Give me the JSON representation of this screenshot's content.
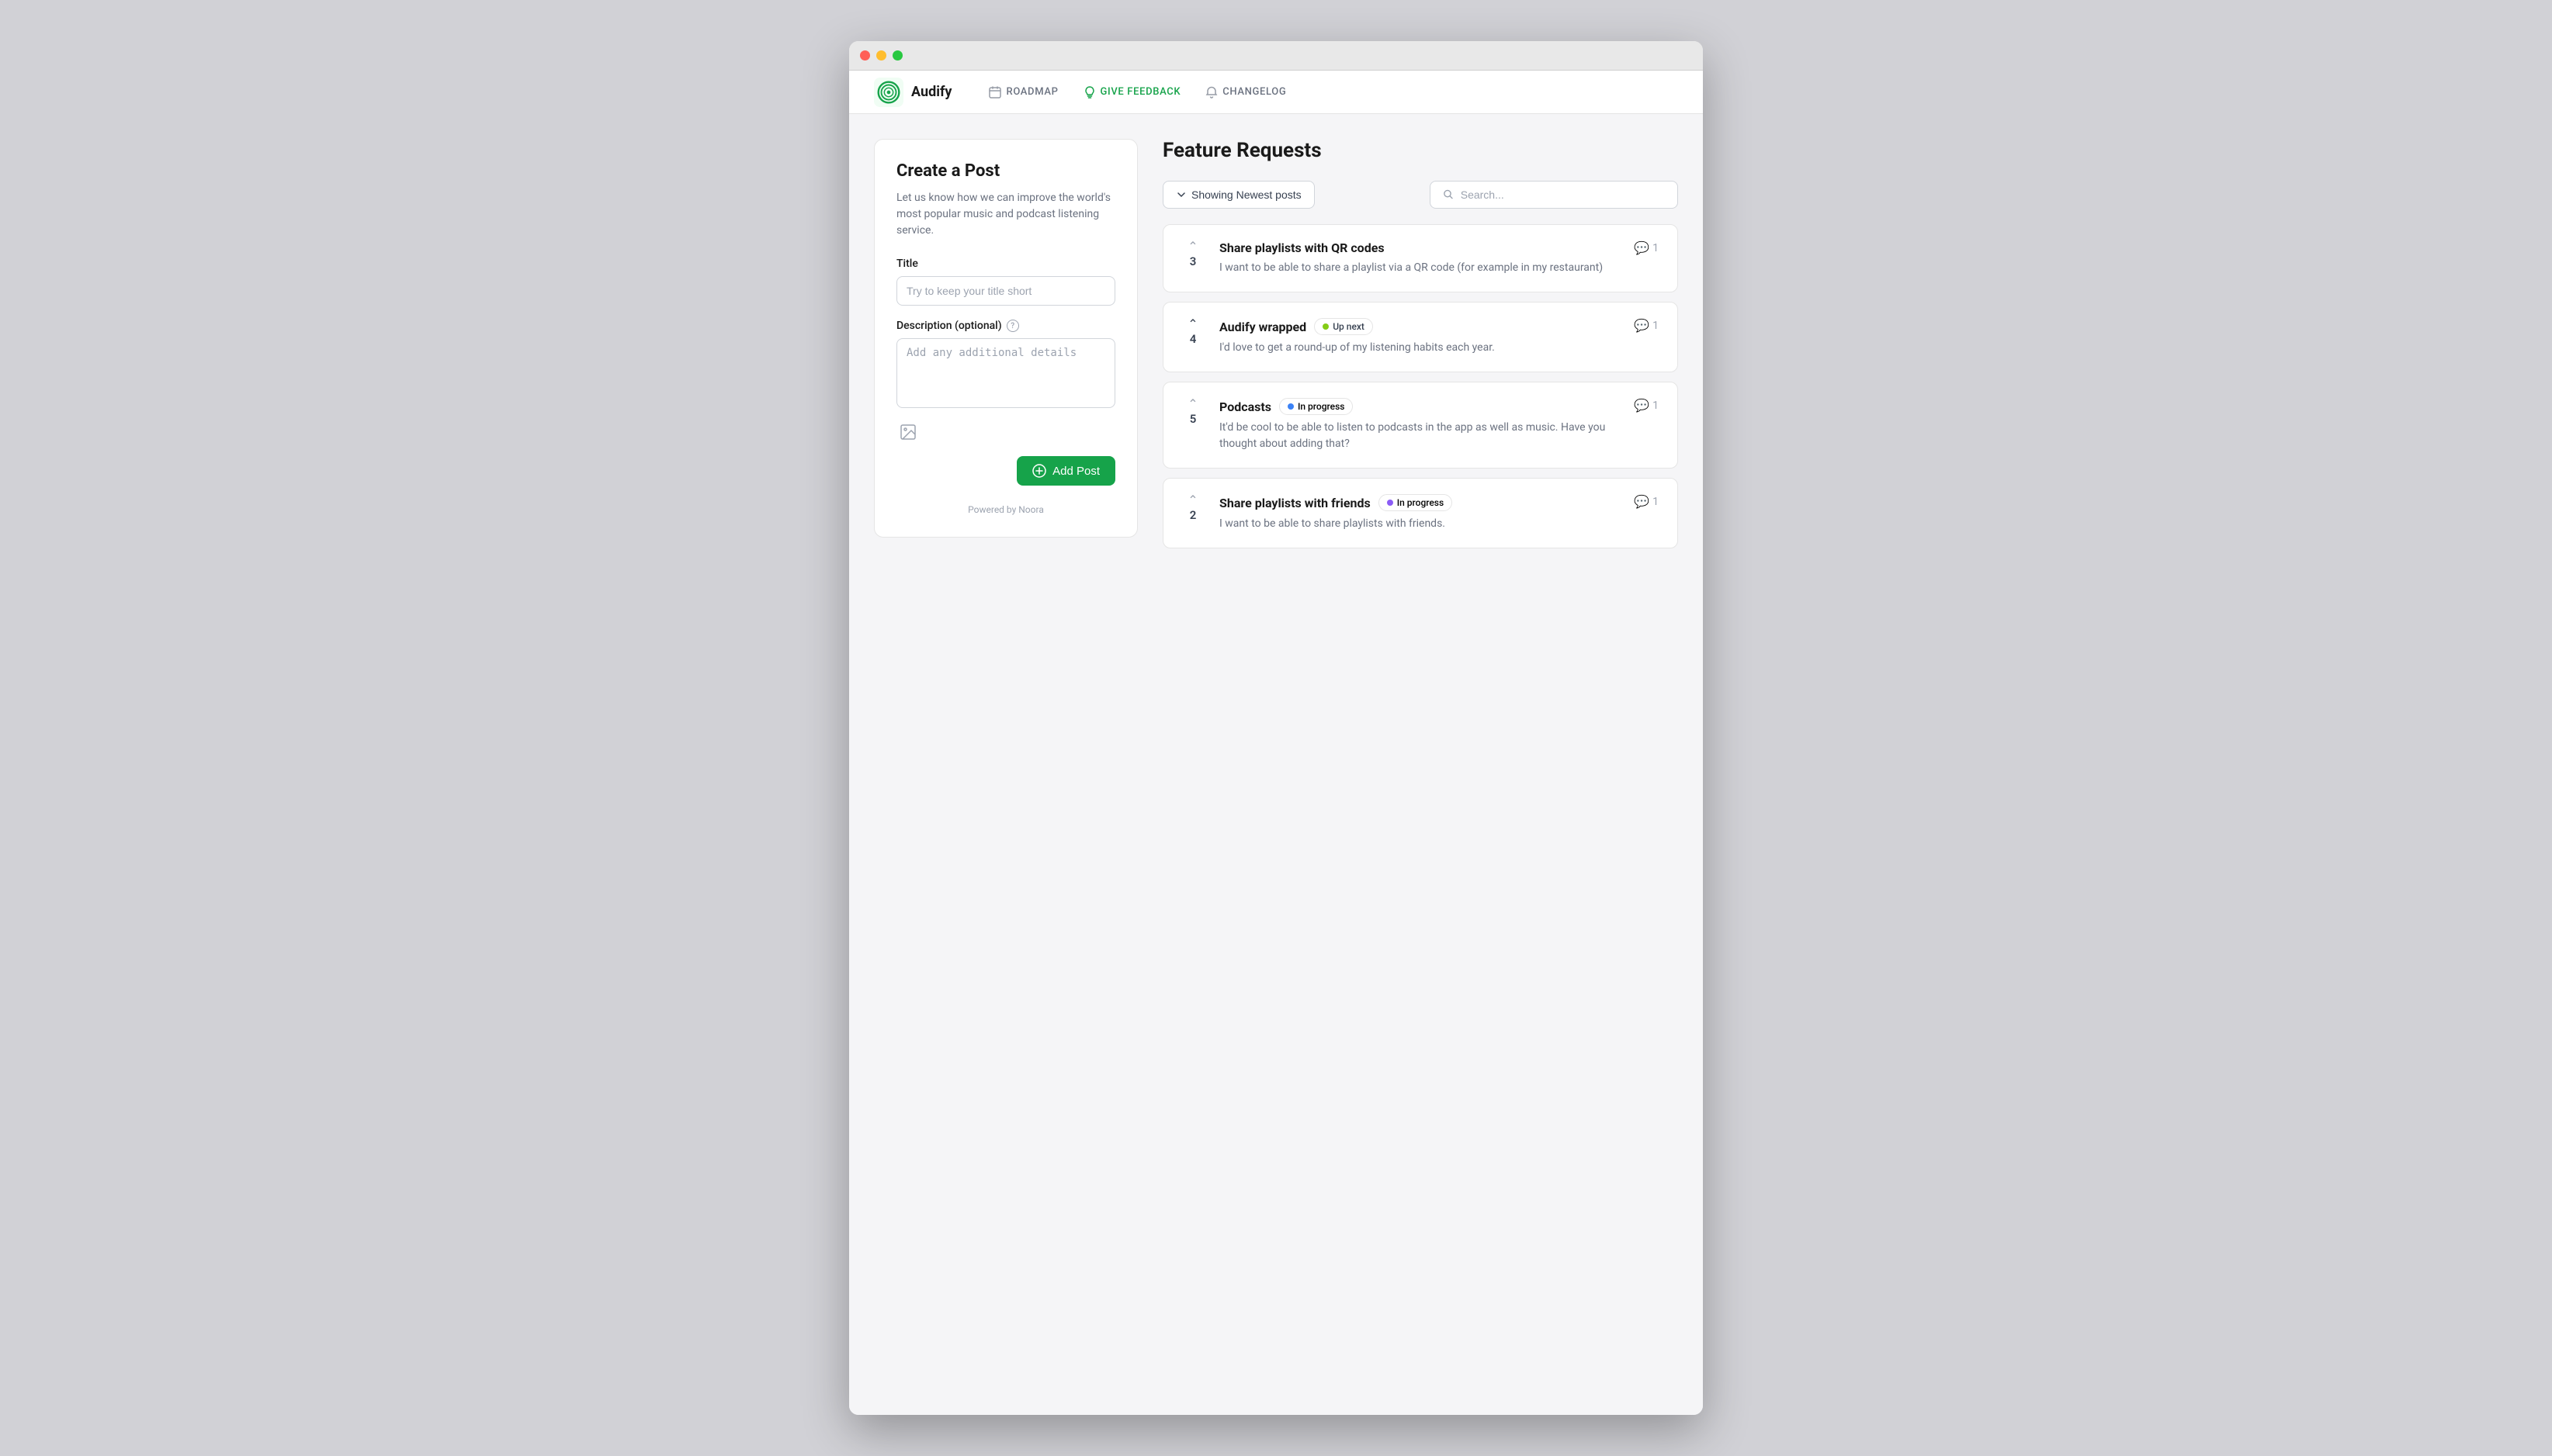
{
  "window": {
    "dots": [
      "red",
      "yellow",
      "green"
    ]
  },
  "navbar": {
    "brand_name": "Audify",
    "nav_items": [
      {
        "label": "ROADMAP",
        "icon": "calendar",
        "active": false
      },
      {
        "label": "GIVE FEEDBACK",
        "icon": "bulb",
        "active": true
      },
      {
        "label": "CHANGELOG",
        "icon": "bell",
        "active": false
      }
    ]
  },
  "create_post": {
    "title": "Create a Post",
    "description": "Let us know how we can improve the world's most popular music and podcast listening service.",
    "title_field_label": "Title",
    "title_placeholder": "Try to keep your title short",
    "description_field_label": "Description (optional)",
    "description_placeholder": "Add any additional details",
    "add_post_label": "Add Post",
    "powered_by": "Powered by Noora"
  },
  "feature_requests": {
    "section_title": "Feature Requests",
    "filter_label": "Showing Newest posts",
    "search_placeholder": "Search...",
    "posts": [
      {
        "id": 1,
        "votes": 3,
        "title": "Share playlists with QR codes",
        "excerpt": "I want to be able to share a playlist via a QR code (for example in my restaurant)",
        "badge": null,
        "comments": 1,
        "arrow_active": false
      },
      {
        "id": 2,
        "votes": 4,
        "title": "Audify wrapped",
        "excerpt": "I'd love to get a round-up of my listening habits each year.",
        "badge": "Up next",
        "badge_color": "green",
        "comments": 1,
        "arrow_active": true
      },
      {
        "id": 3,
        "votes": 5,
        "title": "Podcasts",
        "excerpt": "It'd be cool to be able to listen to podcasts in the app as well as music. Have you thought about adding that?",
        "badge": "In progress",
        "badge_color": "blue",
        "comments": 1,
        "arrow_active": false
      },
      {
        "id": 4,
        "votes": 2,
        "title": "Share playlists with friends",
        "excerpt": "I want to be able to share playlists with friends.",
        "badge": "In progress",
        "badge_color": "purple",
        "comments": 1,
        "arrow_active": false
      }
    ]
  }
}
